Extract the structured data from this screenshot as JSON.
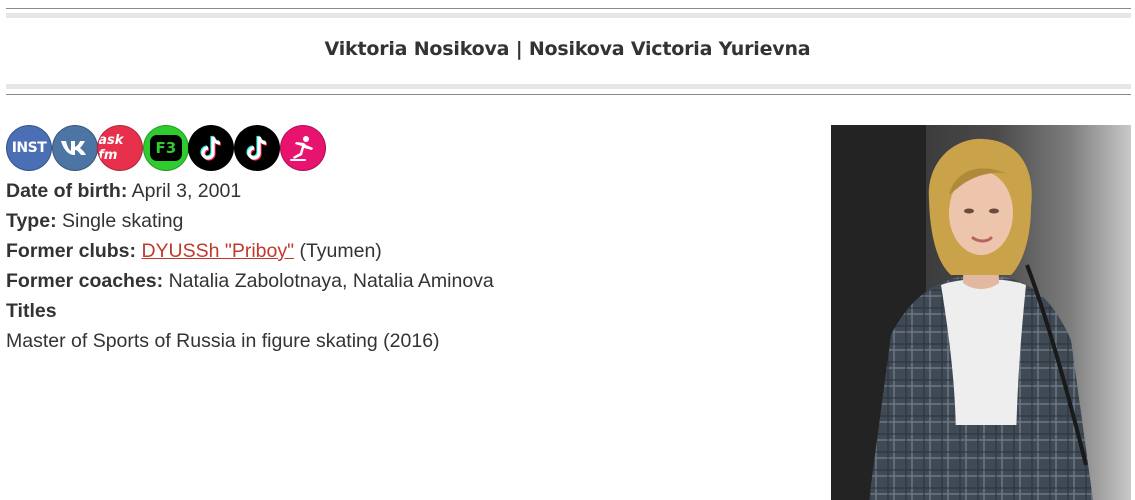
{
  "page": {
    "title": "Viktoria Nosikova | Nosikova Victoria Yurievna"
  },
  "socials": [
    {
      "name": "instagram",
      "label": "INST"
    },
    {
      "name": "vk",
      "label": "VK"
    },
    {
      "name": "askfm",
      "label": "ask fm"
    },
    {
      "name": "fs",
      "label": "F3"
    },
    {
      "name": "tiktok",
      "label": ""
    },
    {
      "name": "tiktok",
      "label": ""
    },
    {
      "name": "figure-skating",
      "label": ""
    }
  ],
  "profile": {
    "dob_label": "Date of birth:",
    "dob_value": "April 3, 2001",
    "type_label": "Type:",
    "type_value": "Single skating",
    "clubs_label": "Former clubs:",
    "clubs_link": "DYUSSh \"Priboy\"",
    "clubs_suffix": "(Tyumen)",
    "coaches_label": "Former coaches:",
    "coaches_value": "Natalia Zabolotnaya, Natalia Aminova",
    "titles_label": "Titles",
    "titles_value": "Master of Sports of Russia in figure skating (2016)"
  },
  "colors": {
    "link": "#c0392b",
    "text": "#333333"
  }
}
